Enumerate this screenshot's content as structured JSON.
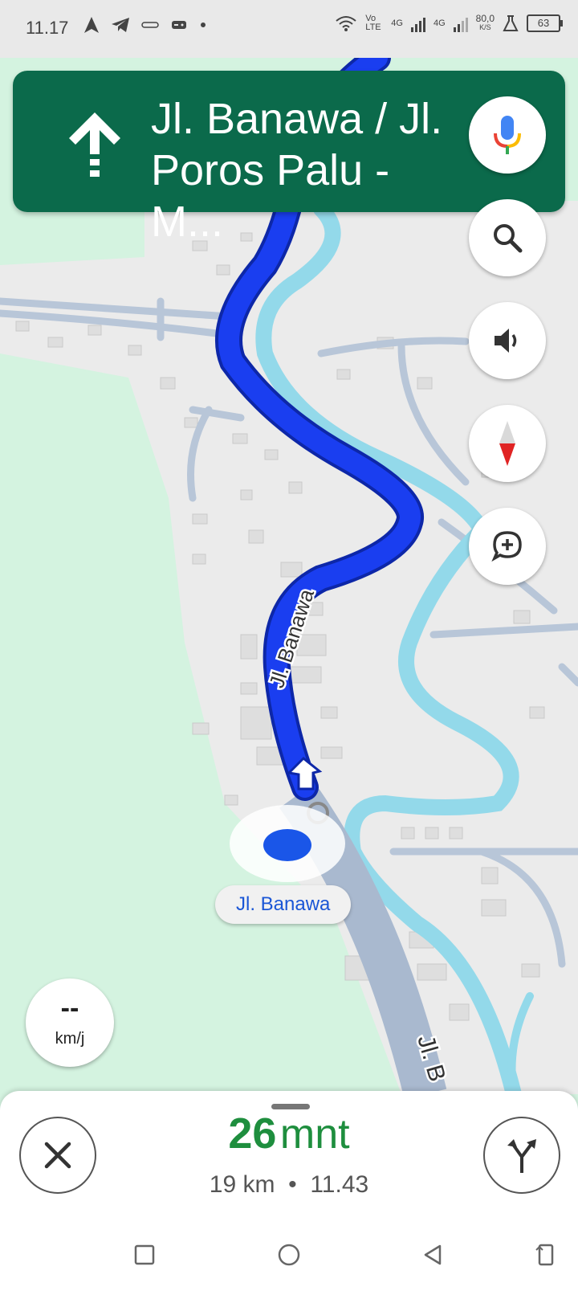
{
  "status_bar": {
    "time": "11.17",
    "volte": "Vo LTE",
    "net1": "4G",
    "net2": "4G",
    "speed": "80,0",
    "speed_unit": "K/S",
    "battery": "63"
  },
  "banner": {
    "street_line1": "Jl. Banawa / Jl.",
    "street_line2": "Poros Palu - M...",
    "maneuver_icon": "straight-arrow-icon",
    "color": "#0b6a4b"
  },
  "map": {
    "road_label_main": "Jl. Banawa",
    "road_label_bottom": "Jl. B",
    "route_color": "#1a3ef0",
    "river_color": "#93d9ea"
  },
  "current_location_label": "Jl. Banawa",
  "speedometer": {
    "value": "--",
    "unit": "km/j"
  },
  "trip": {
    "eta_number": "26",
    "eta_unit": "mnt",
    "distance": "19 km",
    "separator": "•",
    "arrival": "11.43",
    "eta_color": "#1e8e3e"
  },
  "icons": {
    "mic": "microphone-icon",
    "search": "search-icon",
    "sound": "volume-icon",
    "compass": "compass-icon",
    "report": "add-report-icon",
    "close": "close-icon",
    "alternate": "alternate-routes-icon"
  }
}
